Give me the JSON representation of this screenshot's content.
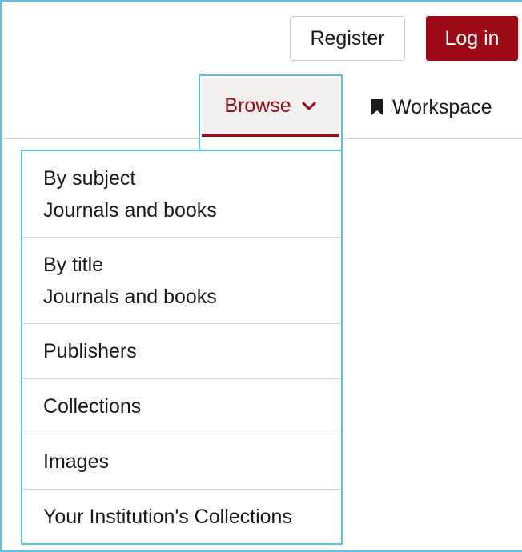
{
  "header": {
    "register_label": "Register",
    "login_label": "Log in"
  },
  "nav": {
    "browse_label": "Browse",
    "workspace_label": "Workspace"
  },
  "browse_menu": {
    "items": [
      {
        "title": "By subject",
        "subtitle": "Journals and books"
      },
      {
        "title": "By title",
        "subtitle": "Journals and books"
      },
      {
        "title": "Publishers"
      },
      {
        "title": "Collections"
      },
      {
        "title": "Images"
      },
      {
        "title": "Your Institution's Collections"
      }
    ]
  },
  "colors": {
    "brand": "#9b0a15",
    "focus_outline": "#5bc4e0"
  },
  "icons": {
    "browse_chevron": "chevron-down-icon",
    "workspace": "bookmark-icon"
  }
}
